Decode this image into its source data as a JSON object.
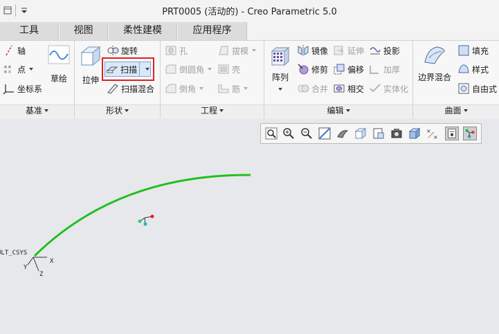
{
  "window": {
    "title": "PRT0005 (活动的) - Creo Parametric 5.0"
  },
  "tabs": [
    {
      "label": "工具"
    },
    {
      "label": "视图"
    },
    {
      "label": "柔性建模"
    },
    {
      "label": "应用程序"
    }
  ],
  "ribbon": {
    "datum": {
      "label": "基准",
      "axis": "轴",
      "point": "点",
      "csys": "坐标系",
      "sketch": "草绘"
    },
    "shapes": {
      "label": "形状",
      "extrude": "拉伸",
      "revolve": "旋转",
      "sweep": "扫描",
      "swept_blend": "扫描混合"
    },
    "engineering": {
      "label": "工程",
      "hole": "孔",
      "round": "倒圆角",
      "chamfer": "倒角",
      "draft": "拔模",
      "shell": "壳",
      "rib": "筋"
    },
    "editing": {
      "label": "编辑",
      "pattern": "阵列",
      "mirror": "镜像",
      "trim": "修剪",
      "merge": "合并",
      "extend": "延伸",
      "offset": "偏移",
      "intersect": "相交",
      "project": "投影",
      "thicken": "加厚",
      "solidify": "实体化"
    },
    "surfaces": {
      "label": "曲面",
      "boundary_blend": "边界混合",
      "fill": "填充",
      "style": "样式",
      "freestyle": "自由式"
    }
  },
  "canvas": {
    "csys_name": "ULT_CSYS",
    "axis_x": "X",
    "axis_y": "Y",
    "axis_z": "Z"
  },
  "colors": {
    "curve": "#1fbf1f",
    "highlight": "#e02020",
    "accent": "#3a7bd5"
  }
}
